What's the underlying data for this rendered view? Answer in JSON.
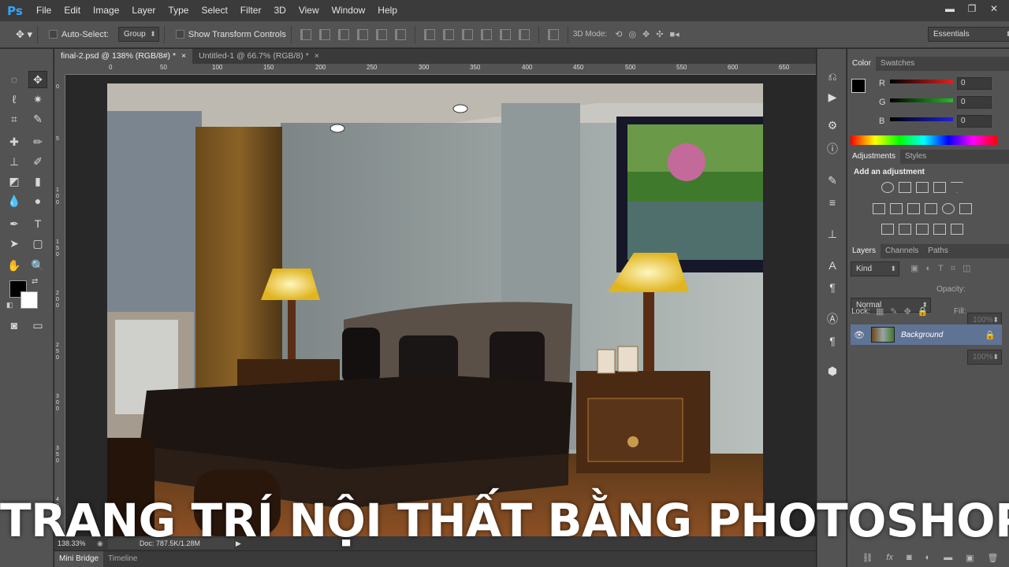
{
  "app": {
    "logo": "Ps"
  },
  "menu": [
    "File",
    "Edit",
    "Image",
    "Layer",
    "Type",
    "Select",
    "Filter",
    "3D",
    "View",
    "Window",
    "Help"
  ],
  "window_controls": {
    "minimize": "▬",
    "restore": "❐",
    "close": "✕"
  },
  "options_bar": {
    "auto_select_label": "Auto-Select:",
    "auto_select_value": "Group",
    "show_transform_label": "Show Transform Controls",
    "mode_label": "3D Mode:",
    "workspace": "Essentials"
  },
  "tabs": [
    {
      "label": "final-2.psd @ 138% (RGB/8#) *",
      "close": "×"
    },
    {
      "label": "Untitled-1 @ 66.7% (RGB/8) *",
      "close": "×"
    }
  ],
  "ruler_top": [
    "0",
    "50",
    "100",
    "150",
    "200",
    "250",
    "300",
    "350",
    "400",
    "450",
    "500",
    "550",
    "600",
    "650"
  ],
  "ruler_left": [
    "0",
    "5",
    "1 0 0",
    "1 5 0",
    "2 0 0",
    "2 5 0",
    "3 0 0",
    "3 5 0",
    "4 0"
  ],
  "status": {
    "zoom": "138.33%",
    "doc": "Doc: 787.5K/1.28M",
    "arrow": "▶"
  },
  "bottom_tabs": [
    "Mini Bridge",
    "Timeline"
  ],
  "color_panel": {
    "tabs": [
      "Color",
      "Swatches"
    ],
    "channels": [
      {
        "name": "R",
        "value": "0",
        "color": "#e02020"
      },
      {
        "name": "G",
        "value": "0",
        "color": "#20c020"
      },
      {
        "name": "B",
        "value": "0",
        "color": "#2020e0"
      }
    ]
  },
  "adjustments_panel": {
    "tabs": [
      "Adjustments",
      "Styles"
    ],
    "heading": "Add an adjustment"
  },
  "layers_panel": {
    "tabs": [
      "Layers",
      "Channels",
      "Paths"
    ],
    "filter": "Kind",
    "blend_mode": "Normal",
    "opacity_label": "Opacity:",
    "opacity_value": "100%",
    "lock_label": "Lock:",
    "fill_label": "Fill:",
    "fill_value": "100%",
    "layers": [
      {
        "name": "Background",
        "visible": true,
        "locked": true
      }
    ],
    "footer_fx": "fx"
  },
  "caption": "TRANG TRÍ NỘI THẤT BẰNG PHOTOSHOP",
  "colors": {
    "accent": "#31a8ff",
    "panel": "#535353",
    "dark": "#282828"
  }
}
